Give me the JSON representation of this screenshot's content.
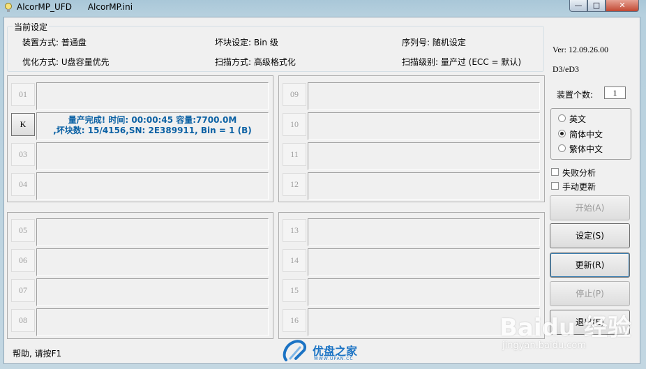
{
  "window": {
    "title": "AlcorMP_UFD      AlcorMP.ini",
    "buttons": {
      "minimize": "—",
      "maximize": "□",
      "close": "✕"
    }
  },
  "settings": {
    "group_title": "当前设定",
    "device_mode": "装置方式: 普通盘",
    "bad_block": "坏块设定: Bin 级",
    "serial": "序列号: 随机设定",
    "optimize": "优化方式: U盘容量优先",
    "scan_mode": "扫描方式: 高级格式化",
    "scan_level": "扫描级别: 量产过 (ECC = 默认)"
  },
  "info": {
    "version": "Ver: 12.09.26.00",
    "code": "D3/eD3",
    "device_count_label": "装置个数:",
    "device_count": "1"
  },
  "language": {
    "options": [
      "英文",
      "简体中文",
      "繁体中文"
    ],
    "selected": "简体中文"
  },
  "checkboxes": {
    "fail_analysis": "失败分析",
    "manual_update": "手动更新"
  },
  "actions": {
    "start": "开始(A)",
    "settings": "设定(S)",
    "refresh": "更新(R)",
    "stop": "停止(P)",
    "exit": "退出(E)"
  },
  "slots": [
    {
      "label": "01",
      "status": ""
    },
    {
      "label": "K",
      "status": "量产完成! 时间: 00:00:45 容量:7700.0M\n,坏块数: 15/4156,SN: 2E389911, Bin = 1 (B)"
    },
    {
      "label": "03",
      "status": ""
    },
    {
      "label": "04",
      "status": ""
    },
    {
      "label": "05",
      "status": ""
    },
    {
      "label": "06",
      "status": ""
    },
    {
      "label": "07",
      "status": ""
    },
    {
      "label": "08",
      "status": ""
    },
    {
      "label": "09",
      "status": ""
    },
    {
      "label": "10",
      "status": ""
    },
    {
      "label": "11",
      "status": ""
    },
    {
      "label": "12",
      "status": ""
    },
    {
      "label": "13",
      "status": ""
    },
    {
      "label": "14",
      "status": ""
    },
    {
      "label": "15",
      "status": ""
    },
    {
      "label": "16",
      "status": ""
    }
  ],
  "status_bar": {
    "help": "帮助, 请按F1"
  },
  "logo": {
    "name": "优盘之家",
    "site": "WWW.UPAN.CC"
  },
  "watermark": {
    "main": "Baidu 经验",
    "sub": "jingyan.baidu.com"
  },
  "colors": {
    "status_text": "#0b61a4",
    "close_button": "#c24832"
  }
}
